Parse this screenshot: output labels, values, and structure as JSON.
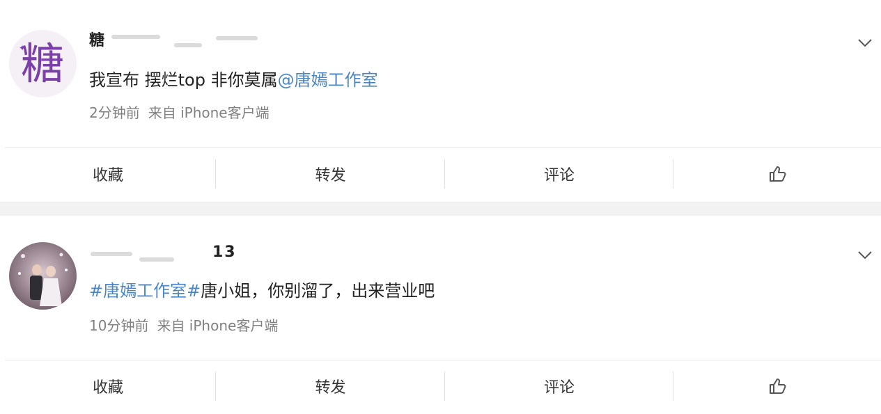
{
  "posts": [
    {
      "username": "糖",
      "username_tail": "",
      "text_plain": "我宣布 摆烂top 非你莫属",
      "text_link": "@唐嫣工作室",
      "time": "2分钟前",
      "source": "来自 iPhone客户端",
      "avatar_char": "糖"
    },
    {
      "username": "",
      "username_tail": "13",
      "text_link": "#唐嫣工作室#",
      "text_plain": "唐小姐，你别溜了，出来营业吧",
      "time": "10分钟前",
      "source": "来自 iPhone客户端",
      "avatar_char": ""
    }
  ],
  "actions": {
    "favorite": "收藏",
    "repost": "转发",
    "comment": "评论",
    "like_icon": "thumbs-up-icon"
  },
  "colors": {
    "link": "#4a86c5",
    "meta": "#808080",
    "separator": "#f2f2f2",
    "avatar_purple": "#7b3fa8"
  }
}
